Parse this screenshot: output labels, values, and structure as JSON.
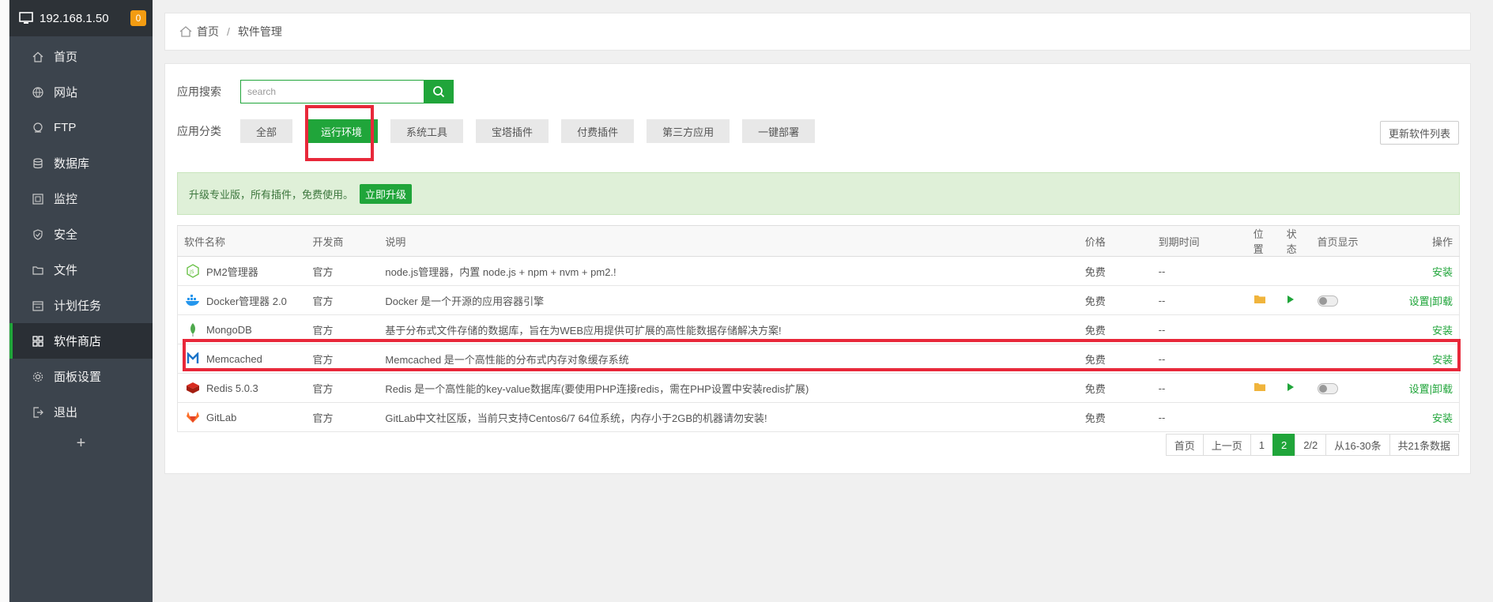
{
  "host": {
    "ip": "192.168.1.50",
    "badge": "0"
  },
  "sidebar": {
    "items": [
      {
        "label": "首页",
        "icon": "home-icon"
      },
      {
        "label": "网站",
        "icon": "globe-icon"
      },
      {
        "label": "FTP",
        "icon": "ftp-icon"
      },
      {
        "label": "数据库",
        "icon": "database-icon"
      },
      {
        "label": "监控",
        "icon": "monitor-icon"
      },
      {
        "label": "安全",
        "icon": "shield-icon"
      },
      {
        "label": "文件",
        "icon": "folder-icon"
      },
      {
        "label": "计划任务",
        "icon": "calendar-icon"
      },
      {
        "label": "软件商店",
        "icon": "grid-icon"
      },
      {
        "label": "面板设置",
        "icon": "gear-icon"
      },
      {
        "label": "退出",
        "icon": "logout-icon"
      }
    ],
    "add": "+"
  },
  "breadcrumb": {
    "home": "首页",
    "sep": "/",
    "current": "软件管理"
  },
  "search": {
    "label": "应用搜索",
    "placeholder": "search"
  },
  "categories": {
    "label": "应用分类",
    "items": [
      "全部",
      "运行环境",
      "系统工具",
      "宝塔插件",
      "付费插件",
      "第三方应用",
      "一键部署"
    ],
    "refresh": "更新软件列表"
  },
  "promo": {
    "text": "升级专业版，所有插件，免费使用。",
    "button": "立即升级"
  },
  "table": {
    "headers": [
      "软件名称",
      "开发商",
      "说明",
      "价格",
      "到期时间",
      "位置",
      "状态",
      "首页显示",
      "操作"
    ],
    "rows": [
      {
        "name": "PM2管理器",
        "dev": "官方",
        "desc": "node.js管理器，内置 node.js + npm + nvm + pm2.!",
        "price": "免费",
        "expire": "--",
        "action": "安装"
      },
      {
        "name": "Docker管理器 2.0",
        "dev": "官方",
        "desc": "Docker 是一个开源的应用容器引擎",
        "price": "免费",
        "expire": "--",
        "action1": "设置",
        "sep": "|",
        "action2": "卸载"
      },
      {
        "name": "MongoDB",
        "dev": "官方",
        "desc": "基于分布式文件存储的数据库，旨在为WEB应用提供可扩展的高性能数据存储解决方案!",
        "price": "免费",
        "expire": "--",
        "action": "安装"
      },
      {
        "name": "Memcached",
        "dev": "官方",
        "desc": "Memcached 是一个高性能的分布式内存对象缓存系统",
        "price": "免费",
        "expire": "--",
        "action": "安装"
      },
      {
        "name": "Redis 5.0.3",
        "dev": "官方",
        "desc": "Redis 是一个高性能的key-value数据库(要使用PHP连接redis，需在PHP设置中安装redis扩展)",
        "price": "免费",
        "expire": "--",
        "action1": "设置",
        "sep": "|",
        "action2": "卸载"
      },
      {
        "name": "GitLab",
        "dev": "官方",
        "desc": "GitLab中文社区版，当前只支持Centos6/7 64位系统，内存小于2GB的机器请勿安装!",
        "price": "免费",
        "expire": "--",
        "action": "安装"
      }
    ]
  },
  "pager": {
    "first": "首页",
    "prev": "上一页",
    "p1": "1",
    "p2": "2",
    "pages": "2/2",
    "range": "从16-30条",
    "total": "共21条数据"
  },
  "colors": {
    "accent": "#20a53a",
    "highlight": "#e8283a",
    "sidebar": "#3c444d"
  }
}
